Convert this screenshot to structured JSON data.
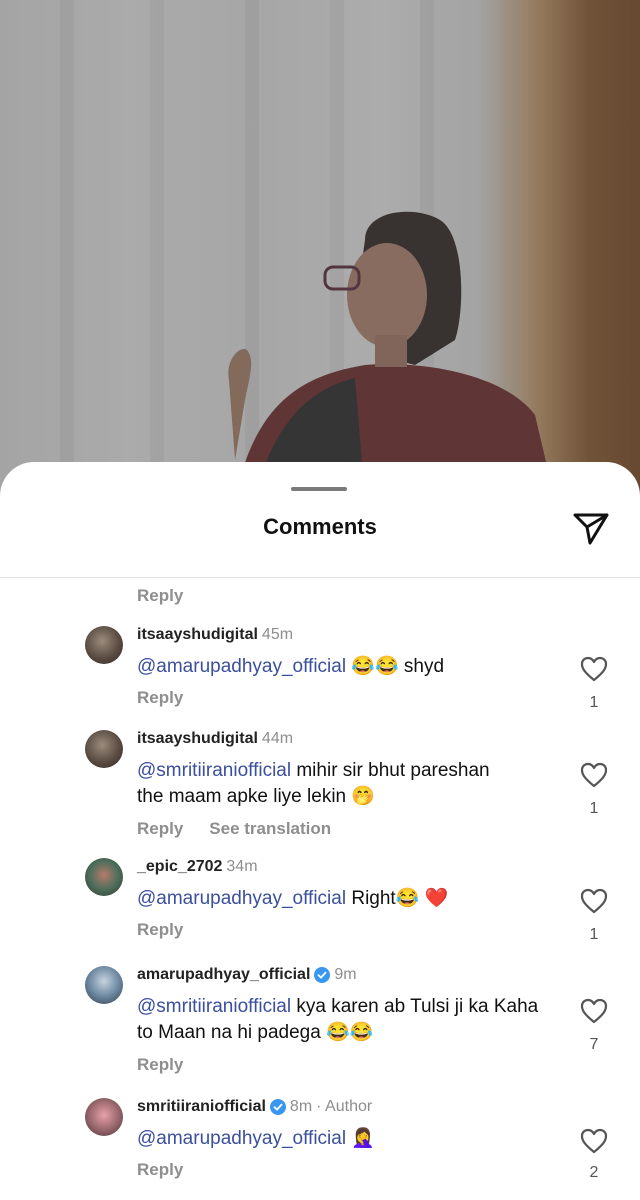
{
  "sheet": {
    "title": "Comments",
    "share_icon": "send-icon"
  },
  "top_reply": "Reply",
  "comments": [
    {
      "username": "itsaayshudigital",
      "time": "45m",
      "mention": "@amarupadhyay_official",
      "body": " 😂😂  shyd",
      "reply": "Reply",
      "likes": "1"
    },
    {
      "username": "itsaayshudigital",
      "time": "44m",
      "mention": "@smritiiraniofficial",
      "body": " mihir sir  bhut pareshan the maam apke liye lekin 🤭",
      "reply": "Reply",
      "translate": "See translation",
      "likes": "1"
    },
    {
      "username": "_epic_2702",
      "time": "34m",
      "mention": "@amarupadhyay_official",
      "body": " Right😂 ❤️",
      "reply": "Reply",
      "likes": "1"
    },
    {
      "username": "amarupadhyay_official",
      "time": "9m",
      "verified": true,
      "mention": "@smritiiraniofficial",
      "body": " kya karen ab Tulsi ji ka Kaha to Maan na hi padega 😂😂",
      "reply": "Reply",
      "likes": "7"
    },
    {
      "username": "smritiiraniofficial",
      "time": "8m",
      "verified": true,
      "author_label": "· Author",
      "mention": "@amarupadhyay_official",
      "body": " 🤦‍♀️",
      "reply": "Reply",
      "likes": "2"
    }
  ],
  "colors": {
    "mention": "#3b4f9e",
    "muted": "#8e8e8e",
    "verified": "#3897f0"
  }
}
